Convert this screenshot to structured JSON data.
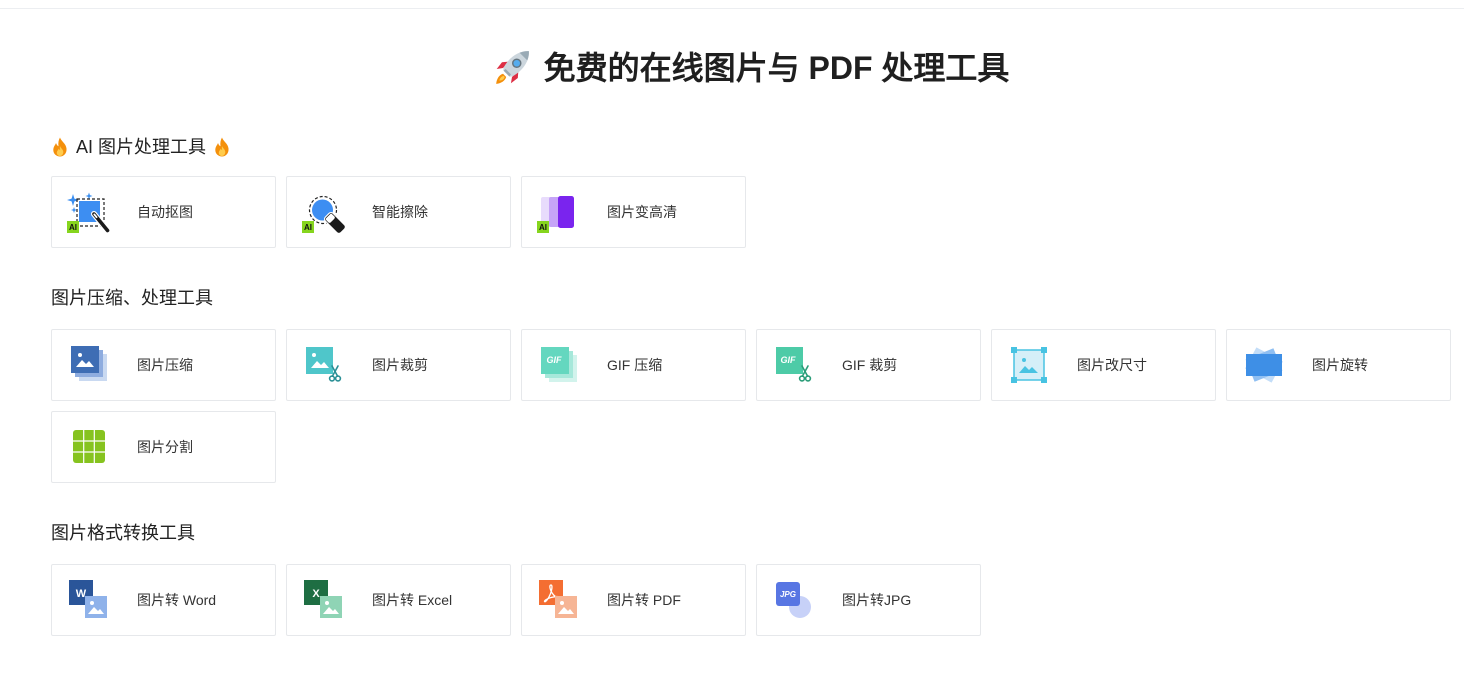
{
  "page": {
    "title": "免费的在线图片与 PDF 处理工具",
    "title_icon": "rocket-icon"
  },
  "sections": [
    {
      "heading": "AI 图片处理工具",
      "heading_icons": [
        "fire-icon",
        "fire-icon"
      ],
      "tools": [
        {
          "label": "自动抠图",
          "icon": "auto-cutout-icon",
          "badge": "AI"
        },
        {
          "label": "智能擦除",
          "icon": "smart-erase-icon",
          "badge": "AI"
        },
        {
          "label": "图片变高清",
          "icon": "image-enhance-icon",
          "badge": "AI"
        }
      ]
    },
    {
      "heading": "图片压缩、处理工具",
      "tools": [
        {
          "label": "图片压缩",
          "icon": "image-compress-icon"
        },
        {
          "label": "图片裁剪",
          "icon": "image-crop-icon"
        },
        {
          "label": "GIF 压缩",
          "icon": "gif-compress-icon",
          "icon_text": "GIF"
        },
        {
          "label": "GIF 裁剪",
          "icon": "gif-crop-icon",
          "icon_text": "GIF"
        },
        {
          "label": "图片改尺寸",
          "icon": "image-resize-icon"
        },
        {
          "label": "图片旋转",
          "icon": "image-rotate-icon"
        },
        {
          "label": "图片分割",
          "icon": "image-split-icon"
        }
      ]
    },
    {
      "heading": "图片格式转换工具",
      "tools": [
        {
          "label": "图片转 Word",
          "icon": "image-to-word-icon",
          "icon_text": "W"
        },
        {
          "label": "图片转 Excel",
          "icon": "image-to-excel-icon",
          "icon_text": "X"
        },
        {
          "label": "图片转 PDF",
          "icon": "image-to-pdf-icon"
        },
        {
          "label": "图片转JPG",
          "icon": "image-to-jpg-icon",
          "icon_text": "JPG"
        }
      ]
    }
  ],
  "colors": {
    "text": "#222222",
    "card_border": "#e6e8eb",
    "ai_badge": "#86d51e",
    "accent_blue": "#3d8ef2",
    "accent_purple": "#7a24ee"
  }
}
